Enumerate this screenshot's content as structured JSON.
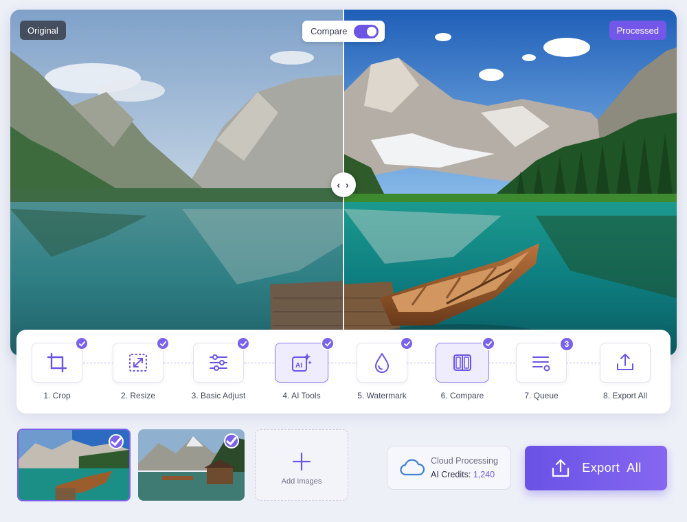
{
  "viewer": {
    "original_label": "Original",
    "processed_label": "Processed",
    "compare_label": "Compare",
    "compare_enabled": true,
    "handle_glyph": "‹ ›"
  },
  "workflow": {
    "steps": [
      {
        "label": "1. Crop",
        "icon": "crop-icon",
        "done": true
      },
      {
        "label": "2. Resize",
        "icon": "resize-icon",
        "done": true
      },
      {
        "label": "3. Basic Adjust",
        "icon": "sliders-icon",
        "done": true
      },
      {
        "label": "4. AI Tools",
        "icon": "ai-sparkle-icon",
        "done": true,
        "active": true
      },
      {
        "label": "5. Watermark",
        "icon": "drop-icon",
        "done": true
      },
      {
        "label": "6. Compare",
        "icon": "split-view-icon",
        "done": true,
        "active": true
      },
      {
        "label": "7. Queue",
        "icon": "queue-icon",
        "badge": "3"
      },
      {
        "label": "8. Export All",
        "icon": "upload-icon"
      }
    ]
  },
  "gallery": {
    "add_label": "Add Images"
  },
  "cloud": {
    "title": "Cloud Processing",
    "credits_label": "AI Credits:",
    "credits_value": "1,240"
  },
  "export": {
    "label": "Export  All"
  },
  "colors": {
    "accent": "#7357e8",
    "background": "#eef0f8"
  }
}
